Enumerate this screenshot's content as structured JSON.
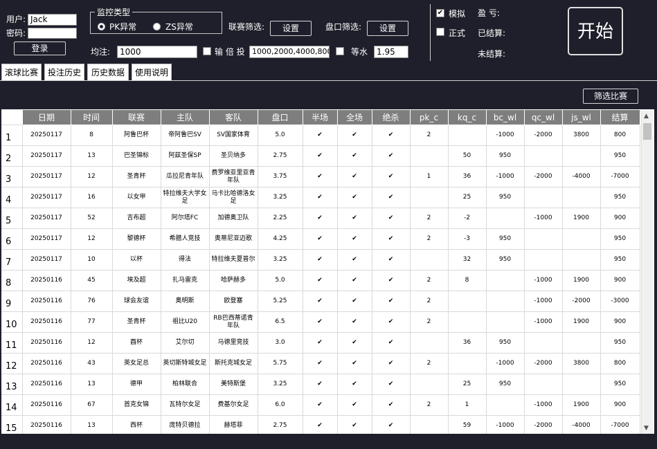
{
  "login": {
    "user_label": "用户:",
    "user_value": "Jack",
    "password_label": "密码:",
    "password_value": "",
    "login_button": "登录"
  },
  "monitor": {
    "group_title": "监控类型",
    "pk_option": "PK异常",
    "zs_option": "ZS异常",
    "selected": "PK异常",
    "league_filter_label": "联赛筛选:",
    "league_filter_button": "设置",
    "odds_filter_label": "盘口筛选:",
    "odds_filter_button": "设置"
  },
  "bet": {
    "avg_label": "均注:",
    "avg_value": "1000",
    "multiplier_label": "输 倍 投",
    "multiplier_checked": false,
    "multiplier_value": "1000,2000,4000,8000",
    "equal_label": "等水",
    "equal_checked": false,
    "equal_value": "1.95"
  },
  "mode": {
    "simulate_label": "模拟",
    "simulate_checked": true,
    "formal_label": "正式",
    "formal_checked": false
  },
  "stats": {
    "profit_label": "盈 亏:",
    "settled_label": "已结算:",
    "unsettled_label": "未结算:"
  },
  "start_button": "开始",
  "tabs": [
    "滚球比赛",
    "投注历史",
    "历史数据",
    "使用说明"
  ],
  "active_tab": "滚球比赛",
  "filter_button": "筛选比赛",
  "table": {
    "columns": [
      "日期",
      "时间",
      "联赛",
      "主队",
      "客队",
      "盘口",
      "半场",
      "全场",
      "绝杀",
      "pk_c",
      "kq_c",
      "bc_wl",
      "qc_wl",
      "js_wl",
      "结算"
    ],
    "rows": [
      [
        "1",
        "20250117",
        "8",
        "阿鲁巴杯",
        "帝阿鲁巴SV",
        "SV国家体育",
        "5.0",
        "✔",
        "✔",
        "✔",
        "2",
        "",
        "-1000",
        "-2000",
        "3800",
        "800"
      ],
      [
        "2",
        "20250117",
        "13",
        "巴圣锦标",
        "阿兹圣保SP",
        "圣贝纳多",
        "2.75",
        "✔",
        "✔",
        "✔",
        "",
        "50",
        "950",
        "",
        "",
        "950"
      ],
      [
        "3",
        "20250117",
        "12",
        "圣青杯",
        "瓜拉尼青年队",
        "费罗维亚里亚青年队",
        "3.75",
        "✔",
        "✔",
        "✔",
        "1",
        "36",
        "-1000",
        "-2000",
        "-4000",
        "-7000"
      ],
      [
        "4",
        "20250117",
        "16",
        "以女甲",
        "特拉维夫大学女足",
        "马卡比哈德洛女足",
        "3.25",
        "✔",
        "✔",
        "✔",
        "",
        "25",
        "950",
        "",
        "",
        "950"
      ],
      [
        "5",
        "20250117",
        "52",
        "吉布超",
        "阿尔塔FC",
        "加德奥卫队",
        "2.25",
        "✔",
        "✔",
        "✔",
        "2",
        "-2",
        "",
        "-1000",
        "1900",
        "900"
      ],
      [
        "6",
        "20250117",
        "12",
        "黎德杯",
        "希腊人竞技",
        "奥蒂尼亚迈歌",
        "4.25",
        "✔",
        "✔",
        "✔",
        "2",
        "-3",
        "950",
        "",
        "",
        "950"
      ],
      [
        "7",
        "20250117",
        "10",
        "以杯",
        "得法",
        "特拉维夫夏普尔",
        "3.25",
        "✔",
        "✔",
        "✔",
        "",
        "32",
        "950",
        "",
        "",
        "950"
      ],
      [
        "8",
        "20250116",
        "45",
        "埃及超",
        "扎马雷克",
        "哈萨赫多",
        "5.0",
        "✔",
        "✔",
        "✔",
        "2",
        "8",
        "",
        "-1000",
        "1900",
        "900"
      ],
      [
        "9",
        "20250116",
        "76",
        "球会友谊",
        "奥明斯",
        "欧登塞",
        "5.25",
        "✔",
        "✔",
        "✔",
        "2",
        "",
        "",
        "-1000",
        "-2000",
        "-3000"
      ],
      [
        "10",
        "20250116",
        "77",
        "圣青杯",
        "祖比U20",
        "RB巴西蒂诺青年队",
        "6.5",
        "✔",
        "✔",
        "✔",
        "2",
        "",
        "",
        "-1000",
        "1900",
        "900"
      ],
      [
        "11",
        "20250116",
        "12",
        "酉杯",
        "艾尔切",
        "马德里竞技",
        "3.0",
        "✔",
        "✔",
        "✔",
        "",
        "36",
        "950",
        "",
        "",
        "950"
      ],
      [
        "12",
        "20250116",
        "43",
        "英女足总",
        "英切斯特城女足",
        "斯托克城女足",
        "5.75",
        "✔",
        "✔",
        "✔",
        "2",
        "",
        "-1000",
        "-2000",
        "3800",
        "800"
      ],
      [
        "13",
        "20250116",
        "13",
        "德甲",
        "柏林联合",
        "美特斯堡",
        "3.25",
        "✔",
        "✔",
        "✔",
        "",
        "25",
        "950",
        "",
        "",
        "950"
      ],
      [
        "14",
        "20250116",
        "67",
        "首克女锦",
        "瓦特尔女足",
        "费基尔女足",
        "6.0",
        "✔",
        "✔",
        "✔",
        "2",
        "1",
        "",
        "-1000",
        "1900",
        "900"
      ],
      [
        "15",
        "20250116",
        "13",
        "西杯",
        "庞特贝德拉",
        "赫塔菲",
        "2.75",
        "✔",
        "✔",
        "✔",
        "",
        "59",
        "-1000",
        "-2000",
        "-4000",
        "-7000"
      ]
    ]
  },
  "colors": {
    "background": "#1f1f2b",
    "header_bg": "#7e7e7e",
    "table_bg": "#ffffff"
  }
}
